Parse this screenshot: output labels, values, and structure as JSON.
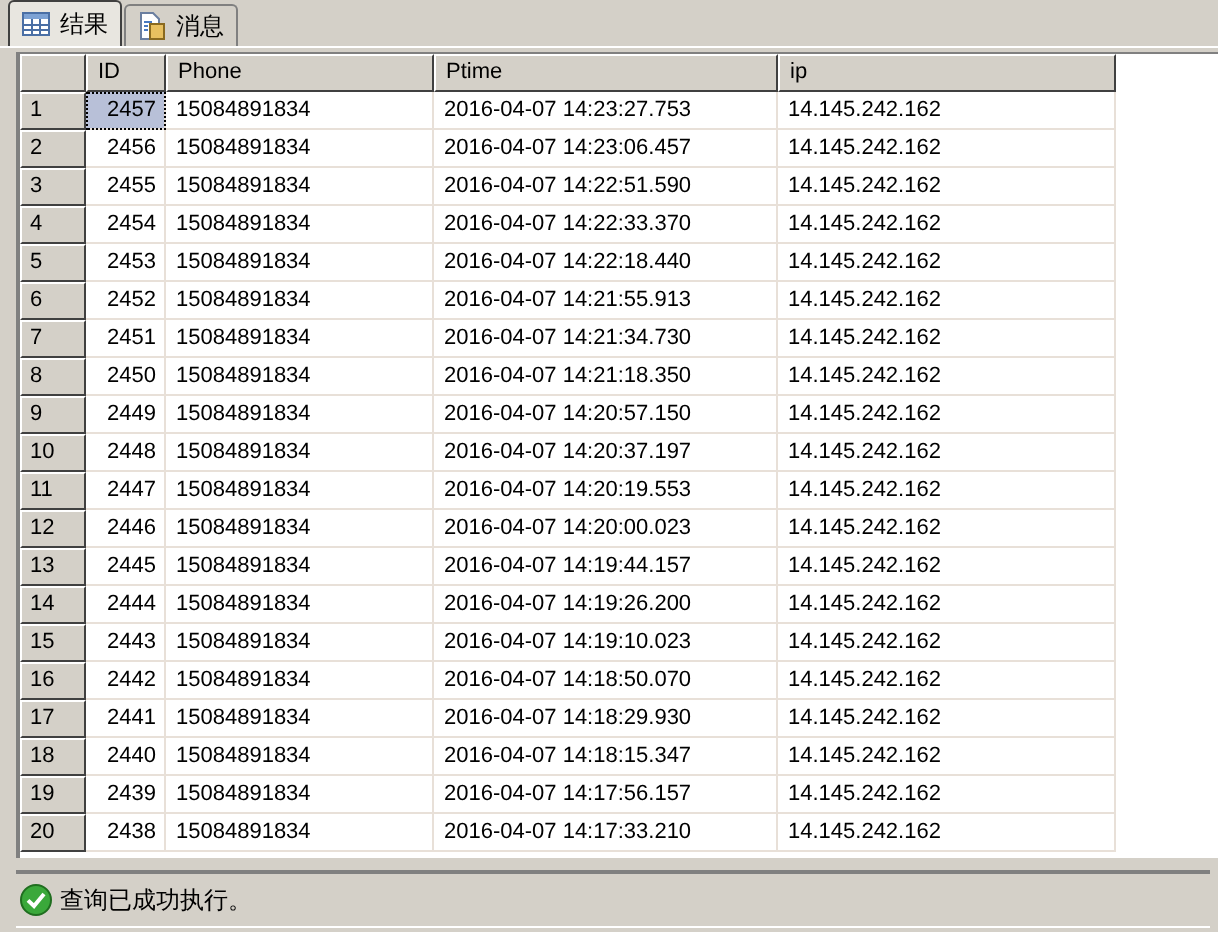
{
  "tabs": [
    {
      "label": "结果",
      "selected": true,
      "kind": "grid"
    },
    {
      "label": "消息",
      "selected": false,
      "kind": "doc"
    }
  ],
  "table": {
    "columns": [
      "ID",
      "Phone",
      "Ptime",
      "ip"
    ],
    "rows": [
      {
        "num": "1",
        "cells": [
          "2457",
          "15084891834",
          "2016-04-07 14:23:27.753",
          "14.145.242.162"
        ],
        "selected": true
      },
      {
        "num": "2",
        "cells": [
          "2456",
          "15084891834",
          "2016-04-07 14:23:06.457",
          "14.145.242.162"
        ],
        "selected": false
      },
      {
        "num": "3",
        "cells": [
          "2455",
          "15084891834",
          "2016-04-07 14:22:51.590",
          "14.145.242.162"
        ],
        "selected": false
      },
      {
        "num": "4",
        "cells": [
          "2454",
          "15084891834",
          "2016-04-07 14:22:33.370",
          "14.145.242.162"
        ],
        "selected": false
      },
      {
        "num": "5",
        "cells": [
          "2453",
          "15084891834",
          "2016-04-07 14:22:18.440",
          "14.145.242.162"
        ],
        "selected": false
      },
      {
        "num": "6",
        "cells": [
          "2452",
          "15084891834",
          "2016-04-07 14:21:55.913",
          "14.145.242.162"
        ],
        "selected": false
      },
      {
        "num": "7",
        "cells": [
          "2451",
          "15084891834",
          "2016-04-07 14:21:34.730",
          "14.145.242.162"
        ],
        "selected": false
      },
      {
        "num": "8",
        "cells": [
          "2450",
          "15084891834",
          "2016-04-07 14:21:18.350",
          "14.145.242.162"
        ],
        "selected": false
      },
      {
        "num": "9",
        "cells": [
          "2449",
          "15084891834",
          "2016-04-07 14:20:57.150",
          "14.145.242.162"
        ],
        "selected": false
      },
      {
        "num": "10",
        "cells": [
          "2448",
          "15084891834",
          "2016-04-07 14:20:37.197",
          "14.145.242.162"
        ],
        "selected": false
      },
      {
        "num": "11",
        "cells": [
          "2447",
          "15084891834",
          "2016-04-07 14:20:19.553",
          "14.145.242.162"
        ],
        "selected": false
      },
      {
        "num": "12",
        "cells": [
          "2446",
          "15084891834",
          "2016-04-07 14:20:00.023",
          "14.145.242.162"
        ],
        "selected": false
      },
      {
        "num": "13",
        "cells": [
          "2445",
          "15084891834",
          "2016-04-07 14:19:44.157",
          "14.145.242.162"
        ],
        "selected": false
      },
      {
        "num": "14",
        "cells": [
          "2444",
          "15084891834",
          "2016-04-07 14:19:26.200",
          "14.145.242.162"
        ],
        "selected": false
      },
      {
        "num": "15",
        "cells": [
          "2443",
          "15084891834",
          "2016-04-07 14:19:10.023",
          "14.145.242.162"
        ],
        "selected": false
      },
      {
        "num": "16",
        "cells": [
          "2442",
          "15084891834",
          "2016-04-07 14:18:50.070",
          "14.145.242.162"
        ],
        "selected": false
      },
      {
        "num": "17",
        "cells": [
          "2441",
          "15084891834",
          "2016-04-07 14:18:29.930",
          "14.145.242.162"
        ],
        "selected": false
      },
      {
        "num": "18",
        "cells": [
          "2440",
          "15084891834",
          "2016-04-07 14:18:15.347",
          "14.145.242.162"
        ],
        "selected": false
      },
      {
        "num": "19",
        "cells": [
          "2439",
          "15084891834",
          "2016-04-07 14:17:56.157",
          "14.145.242.162"
        ],
        "selected": false
      },
      {
        "num": "20",
        "cells": [
          "2438",
          "15084891834",
          "2016-04-07 14:17:33.210",
          "14.145.242.162"
        ],
        "selected": false
      }
    ]
  },
  "status_bar": {
    "text": "查询已成功执行。",
    "kind": "success"
  }
}
